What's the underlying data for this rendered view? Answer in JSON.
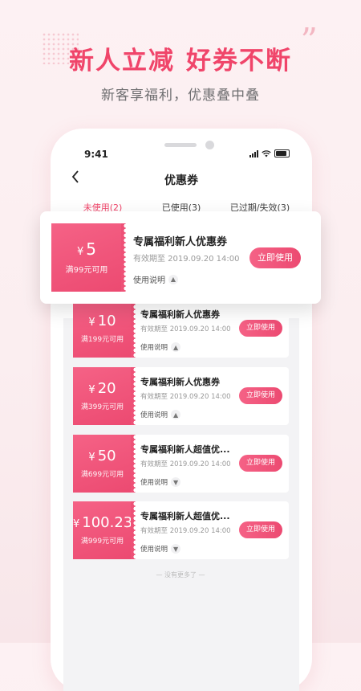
{
  "promo": {
    "headline_part1": "新人立减",
    "headline_part2": "好券不断",
    "subline": "新客享福利，优惠叠中叠",
    "quote_mark": "”"
  },
  "status_bar": {
    "time": "9:41"
  },
  "nav": {
    "back_icon": "chevron-left-icon",
    "title": "优惠券"
  },
  "tabs": [
    {
      "label": "未使用(2)",
      "active": true
    },
    {
      "label": "已使用(3)",
      "active": false
    },
    {
      "label": "已过期/失效(3)",
      "active": false
    }
  ],
  "coupons": [
    {
      "yen": "¥",
      "amount": "5",
      "condition": "满99元可用",
      "title": "专属福利新人优惠券",
      "valid": "有效期至 2019.09.20 14:00",
      "desc": "使用说明",
      "chevron": "▲",
      "button": "立即使用"
    },
    {
      "yen": "¥",
      "amount": "10",
      "condition": "满199元可用",
      "title": "专属福利新人优惠券",
      "valid": "有效期至 2019.09.20 14:00",
      "desc": "使用说明",
      "chevron": "▲",
      "button": "立即使用"
    },
    {
      "yen": "¥",
      "amount": "20",
      "condition": "满399元可用",
      "title": "专属福利新人优惠券",
      "valid": "有效期至 2019.09.20 14:00",
      "desc": "使用说明",
      "chevron": "▲",
      "button": "立即使用"
    },
    {
      "yen": "¥",
      "amount": "50",
      "condition": "满699元可用",
      "title": "专属福利新人超值优...",
      "valid": "有效期至 2019.09.20 14:00",
      "desc": "使用说明",
      "chevron": "▼",
      "button": "立即使用"
    },
    {
      "yen": "¥",
      "amount": "100.23",
      "condition": "满999元可用",
      "title": "专属福利新人超值优...",
      "valid": "有效期至 2019.09.20 14:00",
      "desc": "使用说明",
      "chevron": "▼",
      "button": "立即使用"
    }
  ],
  "footer": "— 没有更多了 —",
  "colors": {
    "accent": "#f0456a",
    "ticket": "#ee5177"
  }
}
